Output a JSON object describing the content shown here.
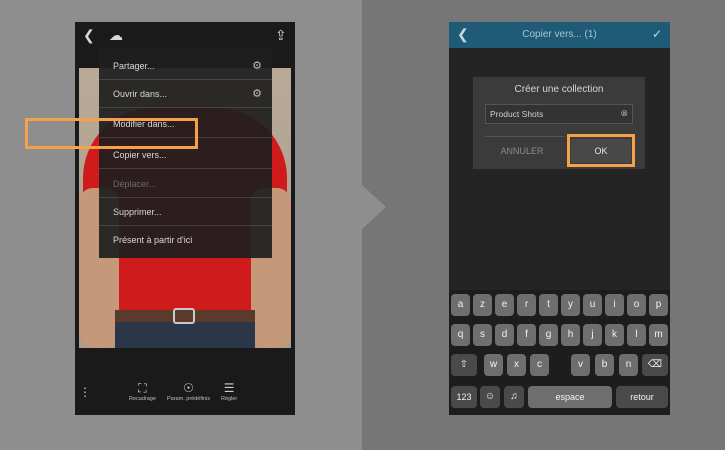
{
  "left_phone": {
    "menu": [
      {
        "label": "Partager...",
        "icon": "gear-icon"
      },
      {
        "label": "Ouvrir dans...",
        "icon": "gear-icon"
      },
      {
        "label": "Modifier dans..."
      },
      {
        "label": "Copier vers..."
      },
      {
        "label": "Déplacer..."
      },
      {
        "label": "Supprimer..."
      },
      {
        "label": "Présent à partir d'ici"
      }
    ],
    "toolbar": [
      {
        "label": "Recadrage",
        "icon": "crop-icon"
      },
      {
        "label": "Param. prédéfinis",
        "icon": "presets-icon"
      },
      {
        "label": "Régler",
        "icon": "sliders-icon"
      }
    ]
  },
  "right_phone": {
    "header_title": "Copier vers... (1)",
    "dialog": {
      "title": "Créer une collection",
      "field_value": "Product Shots",
      "cancel_label": "ANNULER",
      "ok_label": "OK"
    },
    "keyboard": {
      "row1": [
        "a",
        "z",
        "e",
        "r",
        "t",
        "y",
        "u",
        "i",
        "o",
        "p"
      ],
      "row2": [
        "q",
        "s",
        "d",
        "f",
        "g",
        "h",
        "j",
        "k",
        "l",
        "m"
      ],
      "row3": [
        "w",
        "x",
        "c",
        "v",
        "b",
        "n"
      ],
      "num_label": "123",
      "space_label": "espace",
      "return_label": "retour"
    }
  },
  "colors": {
    "highlight": "#f6a04a",
    "header_blue": "#1f5a77",
    "shirt_red": "#cf1b1b"
  }
}
